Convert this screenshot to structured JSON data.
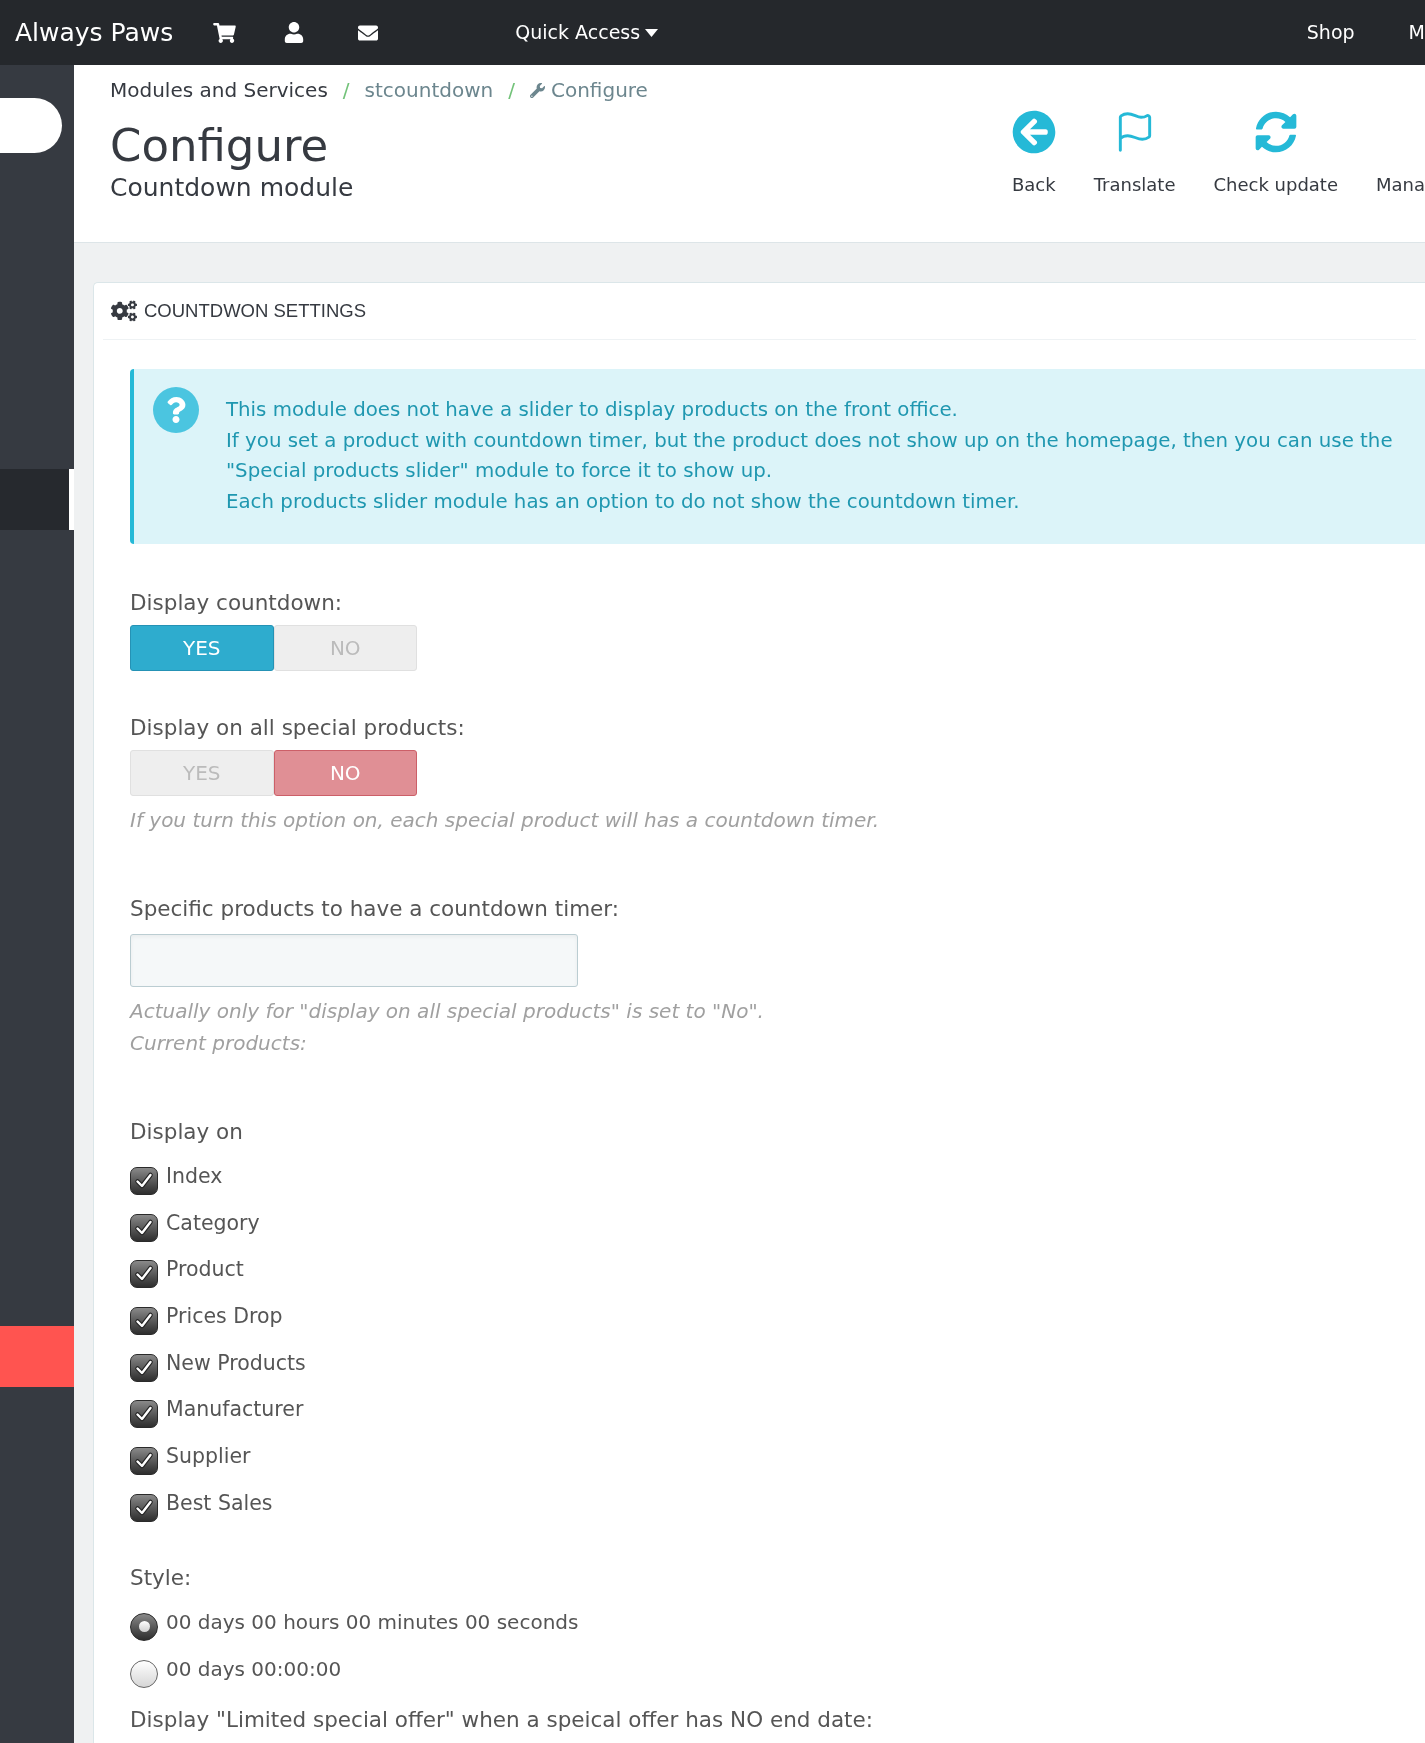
{
  "navbar": {
    "brand": "Always Paws",
    "quick_access": "Quick Access",
    "links": [
      "Shop",
      "M"
    ]
  },
  "sidebar": {
    "items": [
      {
        "selected": true,
        "color": "#26292e"
      },
      {
        "selected": false,
        "color": "#ff5450"
      }
    ]
  },
  "breadcrumb": [
    {
      "kind": "section",
      "label": "Modules and Services"
    },
    {
      "kind": "separator",
      "label": "/"
    },
    {
      "kind": "link",
      "label": "stcountdown"
    },
    {
      "kind": "separator",
      "label": "/"
    },
    {
      "kind": "current",
      "label": "Configure"
    }
  ],
  "page_title": "Configure",
  "page_subtitle": "Countdown module",
  "toolbar": [
    {
      "label": "Back"
    },
    {
      "label": "Translate"
    },
    {
      "label": "Check update"
    },
    {
      "label": "Mana"
    }
  ],
  "panel": {
    "title": "COUNTDWON SETTINGS",
    "info": {
      "lines": [
        "This module does not have a slider to display products on the front office.",
        "If you set a product with countdown timer, but the product does not show up on the homepage, then you can use the",
        "\"Special products slider\" module to force it to show up.",
        "Each products slider module has an option to do not show the countdown timer."
      ]
    },
    "fields": [
      {
        "kind": "switch",
        "label": "Display countdown:",
        "options": [
          {
            "kind": "yes",
            "label": "YES",
            "selected": true
          },
          {
            "kind": "no",
            "label": "NO",
            "selected": false
          }
        ]
      },
      {
        "kind": "switch",
        "label": "Display on all special products:",
        "options": [
          {
            "kind": "yes",
            "label": "YES",
            "selected": false
          },
          {
            "kind": "no",
            "label": "NO",
            "selected": true
          }
        ],
        "help": [
          "If you turn this option on, each special product will has a countdown timer."
        ]
      },
      {
        "kind": "text_input",
        "label": "Specific products to have a countdown timer:",
        "help": [
          "Actually only for \"display on all special products\" is set to \"No\".",
          "Current products:"
        ]
      },
      {
        "kind": "checkbox_group",
        "label": "Display on",
        "items": [
          {
            "label": "Index",
            "checked": true
          },
          {
            "label": "Category",
            "checked": true
          },
          {
            "label": "Product",
            "checked": true
          },
          {
            "label": "Prices Drop",
            "checked": true
          },
          {
            "label": "New Products",
            "checked": true
          },
          {
            "label": "Manufacturer",
            "checked": true
          },
          {
            "label": "Supplier",
            "checked": true
          },
          {
            "label": "Best Sales",
            "checked": true
          }
        ]
      },
      {
        "kind": "radio_group",
        "label": "Style:",
        "options": [
          {
            "label": "00 days 00 hours 00 minutes 00 seconds",
            "selected": true
          },
          {
            "label": "00 days 00:00:00",
            "selected": false
          }
        ]
      },
      {
        "kind": "label",
        "label": "Display \"Limited special offer\" when a speical offer has NO end date:"
      }
    ]
  }
}
